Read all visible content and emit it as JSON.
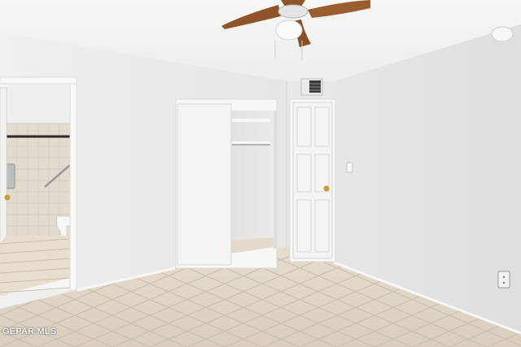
{
  "scene": {
    "description_items": [
      "ceiling-fan",
      "closet",
      "door",
      "bathroom",
      "tile-floor",
      "vent",
      "outlet"
    ],
    "watermark": "GEPAR MLS"
  },
  "colors": {
    "wall_left": "#eeeeec",
    "wall_right": "#e4e4e2",
    "ceiling": "#f3f3f1",
    "floor_tile": "#ddd3c3",
    "grout": "#c8bfb0",
    "door": "#f4f4f2",
    "fan_blade": "#9a5d2e",
    "fan_metal": "#d9d9d9"
  }
}
